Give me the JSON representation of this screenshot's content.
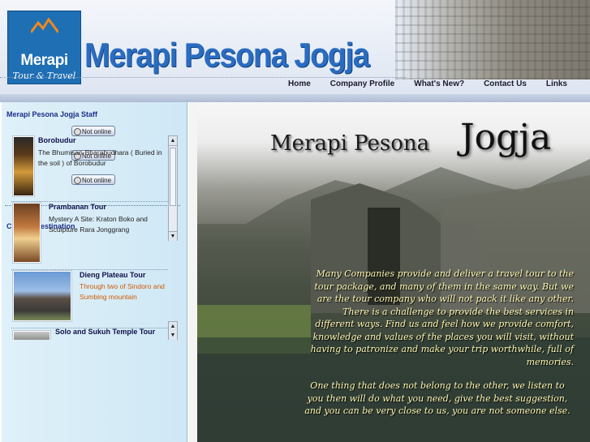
{
  "header": {
    "logo_word": "Merapi",
    "logo_sub": "Tour & Travel",
    "site_title": "Merapi Pesona Jogja",
    "nav": [
      "Home",
      "Company Profile",
      "What's New?",
      "Contact Us",
      "Links"
    ]
  },
  "sidebar": {
    "staff_heading": "Merapi Pesona Jogja Staff",
    "staff_status": [
      "Not online",
      "Not online",
      "Not online"
    ],
    "destination_heading": "Choose Destination",
    "destinations": [
      {
        "title": "Borobudur",
        "desc": "The Bhumisan-Bharabudhara ( Buried in the soil ) of Borobudur"
      },
      {
        "title": "Prambanan Tour",
        "desc": "Mystery A Site: Kraton Boko and Sculpture Rara Jonggrang"
      },
      {
        "title": "Dieng Plateau Tour",
        "desc": "Through two of Sindoro and Sumbing mountain"
      },
      {
        "title": "Solo and Sukuh Temple Tour",
        "desc": ""
      }
    ]
  },
  "hero": {
    "title_part1": "Merapi Pesona",
    "title_part2": "Jogja",
    "paragraph1": "Many Companies provide and deliver a travel tour to the tour package, and many of them in the same way. But we are the tour company who will not pack it like any other. There is a challenge to provide the best services in different ways. Find us and feel how we provide comfort, knowledge and values of the places you will visit, without having to patronize and make your trip worthwhile, full of memories.",
    "paragraph2": "One thing that does not belong to the other, we listen to you then will do what you need, give the best suggestion, and you can be very close to us, you are not someone else."
  },
  "colors": {
    "brand_blue": "#2a6cc0",
    "sidebar_bg": "#dff0f9",
    "hero_text": "#fff8b0",
    "dest_orange": "#d05a00"
  }
}
